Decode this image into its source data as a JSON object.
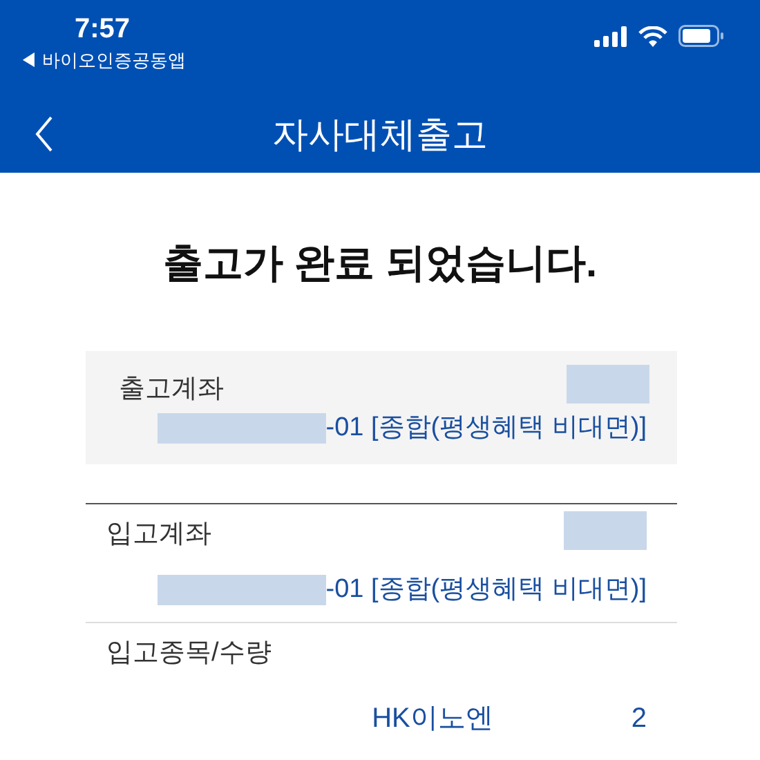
{
  "status_bar": {
    "time": "7:57",
    "back_app": "◀ 바이오인증공동앱"
  },
  "header": {
    "title": "자사대체출고"
  },
  "message": "출고가 완료 되었습니다.",
  "sections": [
    {
      "label": "출고계좌",
      "account": "-01 [종합(평생혜택 비대면)]",
      "shaded": true
    },
    {
      "label": "입고계좌",
      "account": "-01 [종합(평생혜택 비대면)]",
      "shaded": false
    }
  ],
  "holding": {
    "label": "입고종목/수량",
    "name": "HK이노엔",
    "quantity": "2"
  }
}
